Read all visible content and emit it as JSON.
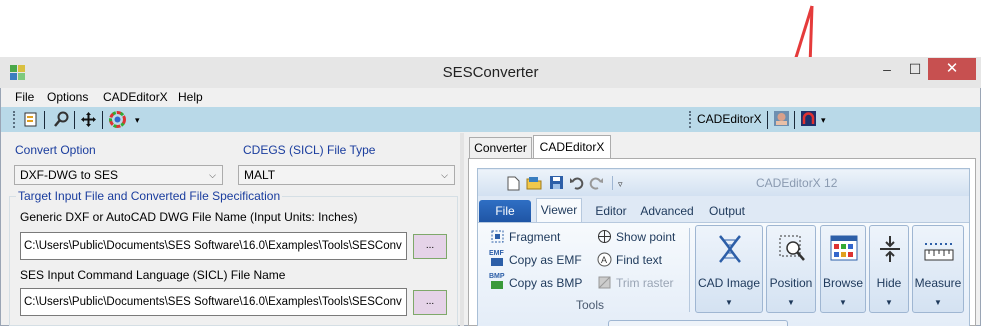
{
  "window": {
    "title": "SESConverter",
    "minimize": "–",
    "maximize": "☐",
    "close": "✕"
  },
  "menu": [
    "File",
    "Options",
    "CADEditorX",
    "Help"
  ],
  "toolbar": {
    "cad_label": "CADEditorX",
    "overflow": "▾"
  },
  "left": {
    "convert_option_label": "Convert Option",
    "convert_option_value": "DXF-DWG to SES",
    "file_type_label": "CDEGS (SICL) File Type",
    "file_type_value": "MALT",
    "group_title": "Target Input File and Converted File Specification",
    "input_label": "Generic DXF or AutoCAD DWG File Name  (Input Units: Inches)",
    "input_path": "C:\\Users\\Public\\Documents\\SES Software\\16.0\\Examples\\Tools\\SESConv",
    "output_label": "SES Input Command Language (SICL) File Name",
    "output_path": "C:\\Users\\Public\\Documents\\SES Software\\16.0\\Examples\\Tools\\SESConv",
    "browse": "..."
  },
  "tabs": [
    "Converter",
    "CADEditorX"
  ],
  "cad": {
    "title": "CADEditorX 12",
    "ribbon_tabs": [
      "File",
      "Viewer",
      "Editor",
      "Advanced",
      "Output"
    ],
    "tools": {
      "fragment": "Fragment",
      "copy_emf": "Copy as EMF",
      "copy_bmp": "Copy as BMP",
      "show_point": "Show point",
      "find_text": "Find text",
      "trim_raster": "Trim raster",
      "group_label": "Tools",
      "emf_tag": "EMF",
      "bmp_tag": "BMP"
    },
    "big_buttons": [
      "CAD Image",
      "Position",
      "Browse",
      "Hide",
      "Measure"
    ]
  },
  "colors": {
    "accent_blue": "#1a3d9e",
    "toolbar_band": "#b9d9e8",
    "close_red": "#c75050",
    "annotation_red": "#e53b3b"
  }
}
